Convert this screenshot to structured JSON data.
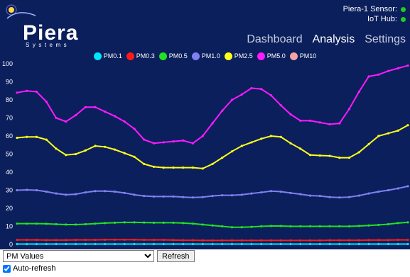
{
  "header": {
    "brand": "Piera",
    "tagline": "Systems",
    "status": [
      {
        "label": "Piera-1 Sensor:",
        "color": "#22cc22"
      },
      {
        "label": "IoT Hub:",
        "color": "#22cc22"
      }
    ],
    "nav": [
      {
        "label": "Dashboard",
        "active": false
      },
      {
        "label": "Analysis",
        "active": true
      },
      {
        "label": "Settings",
        "active": false
      }
    ]
  },
  "chart_data": {
    "type": "line",
    "title": "",
    "xlabel": "",
    "ylabel": "",
    "ylim": [
      0,
      100
    ],
    "yticks": [
      0,
      10,
      20,
      30,
      40,
      50,
      60,
      70,
      80,
      90,
      100
    ],
    "grid": false,
    "legend": "top",
    "x": [
      0,
      1,
      2,
      3,
      4,
      5,
      6,
      7,
      8,
      9,
      10,
      11,
      12,
      13,
      14,
      15,
      16,
      17,
      18,
      19,
      20,
      21,
      22,
      23,
      24,
      25,
      26,
      27,
      28,
      29,
      30,
      31,
      32,
      33,
      34,
      35,
      36,
      37,
      38,
      39,
      40
    ],
    "series": [
      {
        "name": "PM0.1",
        "color": "#00e5ff",
        "values": [
          0.2,
          0.2,
          0.2,
          0.2,
          0.2,
          0.2,
          0.2,
          0.2,
          0.2,
          0.2,
          0.2,
          0.2,
          0.2,
          0.2,
          0.2,
          0.2,
          0.2,
          0.2,
          0.2,
          0.2,
          0.2,
          0.2,
          0.2,
          0.2,
          0.2,
          0.2,
          0.2,
          0.2,
          0.2,
          0.2,
          0.2,
          0.2,
          0.2,
          0.2,
          0.2,
          0.2,
          0.2,
          0.2,
          0.2,
          0.2,
          0.2
        ]
      },
      {
        "name": "PM0.3",
        "color": "#ff1a1a",
        "values": [
          2.5,
          2.5,
          2.5,
          2.4,
          2.4,
          2.4,
          2.5,
          2.5,
          2.5,
          2.6,
          2.6,
          2.6,
          2.6,
          2.5,
          2.5,
          2.5,
          2.4,
          2.3,
          2.3,
          2.2,
          2.2,
          2.2,
          2.2,
          2.2,
          2.2,
          2.2,
          2.2,
          2.2,
          2.2,
          2.2,
          2.2,
          2.2,
          2.3,
          2.3,
          2.3,
          2.3,
          2.4,
          2.4,
          2.4,
          2.5,
          2.5
        ]
      },
      {
        "name": "PM0.5",
        "color": "#22e022",
        "values": [
          11.5,
          11.5,
          11.5,
          11.4,
          11.2,
          11.0,
          11.0,
          11.2,
          11.5,
          11.8,
          12.0,
          12.2,
          12.2,
          12.1,
          12.0,
          12.0,
          12.0,
          11.8,
          11.5,
          11.0,
          10.5,
          10.0,
          9.5,
          9.5,
          9.7,
          10.0,
          10.2,
          10.2,
          10.0,
          10.0,
          10.0,
          10.0,
          10.0,
          10.0,
          10.0,
          10.2,
          10.5,
          10.8,
          11.2,
          11.8,
          12.2
        ]
      },
      {
        "name": "PM1.0",
        "color": "#8080f0",
        "values": [
          30.0,
          30.2,
          30.0,
          29.2,
          28.2,
          27.5,
          27.8,
          28.8,
          29.5,
          29.5,
          29.2,
          28.5,
          27.5,
          26.8,
          26.5,
          26.5,
          26.5,
          26.2,
          26.0,
          26.2,
          26.8,
          27.2,
          27.2,
          27.5,
          28.2,
          28.8,
          29.5,
          29.2,
          28.5,
          27.8,
          27.0,
          26.8,
          26.2,
          26.0,
          26.2,
          27.0,
          28.2,
          29.2,
          30.0,
          31.0,
          32.2
        ]
      },
      {
        "name": "PM2.5",
        "color": "#ffff1a",
        "values": [
          59.0,
          59.5,
          59.5,
          58.0,
          53.0,
          49.5,
          50.0,
          52.0,
          54.5,
          54.0,
          52.5,
          50.5,
          48.5,
          44.5,
          43.0,
          42.5,
          42.5,
          42.5,
          42.5,
          42.0,
          44.5,
          48.0,
          51.5,
          54.5,
          56.5,
          58.5,
          60.0,
          59.5,
          56.0,
          53.0,
          49.5,
          49.2,
          49.0,
          48.0,
          48.0,
          51.0,
          55.5,
          60.0,
          61.5,
          63.0,
          66.0
        ]
      },
      {
        "name": "PM5.0",
        "color": "#ff1aff",
        "values": [
          84.0,
          85.0,
          84.5,
          79.0,
          70.0,
          68.0,
          71.5,
          76.0,
          76.0,
          73.5,
          71.0,
          68.0,
          64.0,
          58.0,
          56.0,
          56.5,
          57.0,
          57.5,
          56.0,
          60.0,
          67.0,
          74.0,
          80.0,
          83.0,
          86.5,
          86.0,
          82.5,
          77.0,
          72.0,
          68.5,
          68.5,
          67.5,
          66.5,
          67.0,
          75.0,
          84.5,
          93.0,
          94.0,
          96.0,
          97.5,
          99.0
        ]
      },
      {
        "name": "PM10",
        "color": "#f5a3a3",
        "values": []
      }
    ]
  },
  "controls": {
    "select_value": "PM Values",
    "refresh_label": "Refresh",
    "auto_refresh_label": "Auto-refresh",
    "auto_refresh_checked": true
  }
}
